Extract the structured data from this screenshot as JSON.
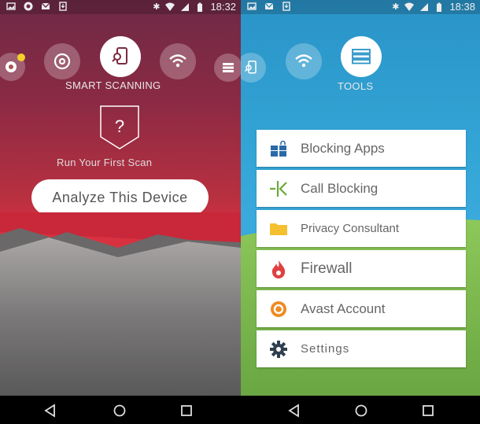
{
  "left_screen": {
    "status_bar": {
      "time": "18:32",
      "notification_icons": [
        "image-icon",
        "avast-icon",
        "gmail-icon",
        "download-icon"
      ],
      "system_icons": [
        "bluetooth-icon",
        "wifi-icon",
        "signal-icon",
        "battery-icon"
      ]
    },
    "carousel": [
      {
        "icon": "avast-account-icon",
        "badge": true
      },
      {
        "icon": "cleaner-swirl-icon"
      },
      {
        "icon": "smart-scan-icon",
        "active": true
      },
      {
        "icon": "wifi-icon"
      },
      {
        "icon": "tools-menu-icon"
      }
    ],
    "section_title": "SMART SCANNING",
    "shield_symbol": "?",
    "subtitle": "Run Your First Scan",
    "analyze_button": "Analyze This Device"
  },
  "right_screen": {
    "status_bar": {
      "time": "18:38",
      "notification_icons": [
        "image-icon",
        "gmail-icon",
        "download-icon"
      ],
      "system_icons": [
        "bluetooth-icon",
        "wifi-icon",
        "signal-icon",
        "battery-icon"
      ]
    },
    "carousel": [
      {
        "icon": "smart-scan-icon"
      },
      {
        "icon": "wifi-icon"
      },
      {
        "icon": "tools-menu-icon",
        "active": true
      }
    ],
    "section_title": "TOOLS",
    "menu": [
      {
        "label": "Blocking Apps",
        "icon": "app-lock-icon",
        "color": "#2a6aa6"
      },
      {
        "label": "Call Blocking",
        "icon": "call-block-icon",
        "color": "#6aaa3a"
      },
      {
        "label": "Privacy Consultant",
        "icon": "folder-icon",
        "color": "#f5c030"
      },
      {
        "label": "Firewall",
        "icon": "flame-icon",
        "color": "#e04040"
      },
      {
        "label": "Avast Account",
        "icon": "avast-account-icon",
        "color": "#f08a20"
      },
      {
        "label": "Settings",
        "icon": "gear-icon",
        "color": "#2f3f4f"
      }
    ]
  },
  "nav_bar": {
    "buttons": [
      "back",
      "home",
      "recents"
    ]
  }
}
